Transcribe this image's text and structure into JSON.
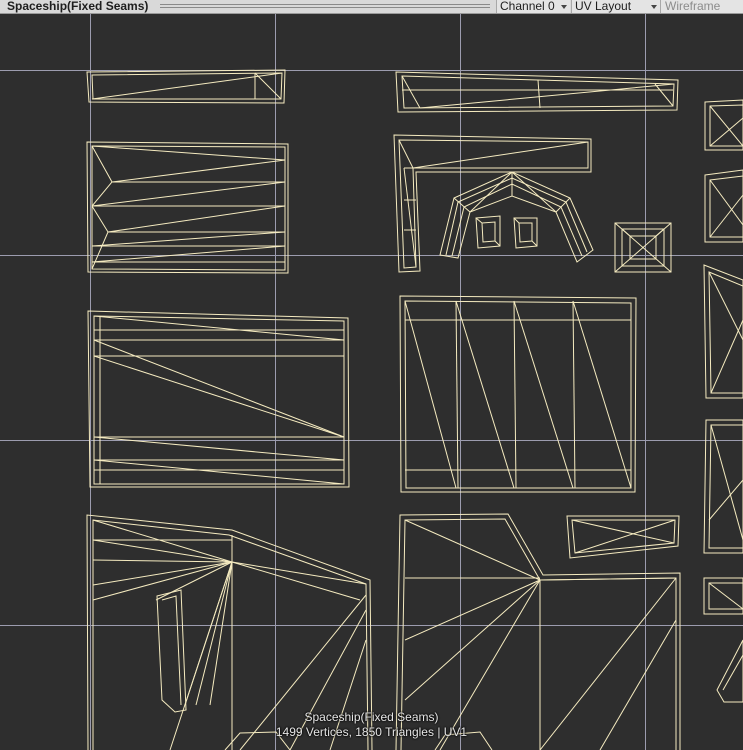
{
  "window": {
    "title": "Spaceship(Fixed Seams)"
  },
  "toolbar": {
    "channel_label": "Channel 0",
    "layout_label": "UV Layout",
    "wireframe_label": "Wireframe"
  },
  "status": {
    "mesh_name": "Spaceship(Fixed Seams)",
    "stats": "1499 Vertices, 1850 Triangles | UV1"
  },
  "colors": {
    "background": "#2e2e2e",
    "wire": "#f5ebc0",
    "grid": "#b8b8d0"
  }
}
